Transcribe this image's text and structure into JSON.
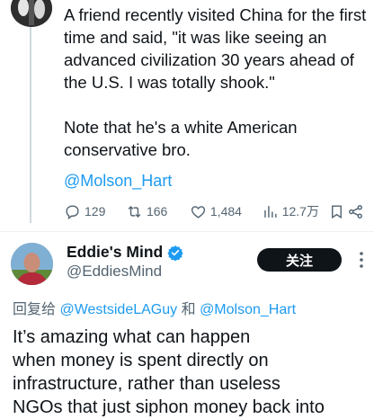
{
  "original_tweet": {
    "lines_para1": [
      "A friend recently visited China for the first",
      "time and said, \"it was like seeing an",
      "advanced civilization 30 years ahead of",
      "the U.S. I was totally shook.\""
    ],
    "lines_para2": [
      "Note that he's a white American",
      "conservative bro."
    ],
    "mention": "@Molson_Hart",
    "stats": {
      "replies": "129",
      "retweets": "166",
      "likes": "1,484",
      "views": "12.7万"
    },
    "icons": [
      "reply-icon",
      "retweet-icon",
      "heart-icon",
      "views-icon",
      "bookmark-icon",
      "share-icon"
    ]
  },
  "reply_tweet": {
    "display_name": "Eddie's Mind",
    "handle": "@EddiesMind",
    "follow_label": "关注",
    "reply_prefix": "回复给",
    "reply_mention_1": "@WestsideLAGuy",
    "reply_conjunction": "和",
    "reply_mention_2": "@Molson_Hart",
    "lines": [
      "It’s amazing what can happen",
      "when money is spent directly on",
      "infrastructure, rather than useless",
      "NGOs that just siphon money back into"
    ]
  },
  "colors": {
    "accent": "#1d9bf0",
    "text": "#0f1419",
    "muted": "#536471",
    "follow_bg": "#0f1419"
  }
}
